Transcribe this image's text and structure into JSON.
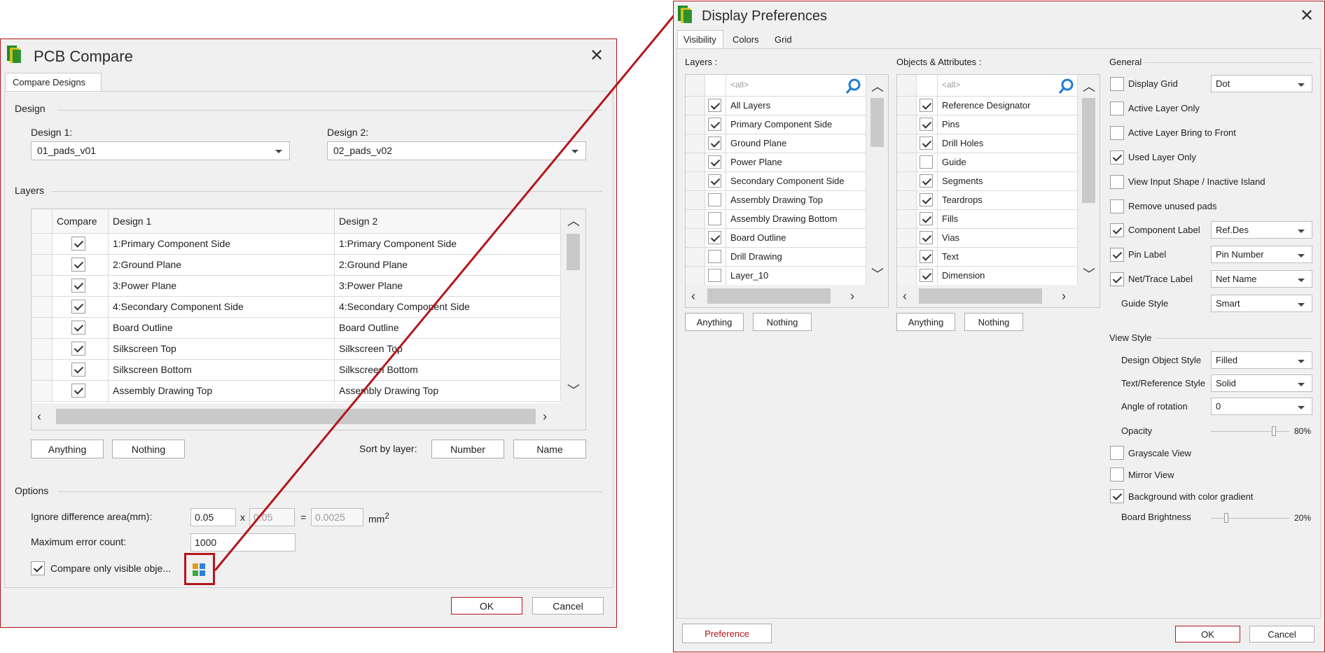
{
  "pcb_compare": {
    "title": "PCB Compare",
    "close": "✕",
    "tab": "Compare Designs",
    "design_section": "Design",
    "design1_label": "Design 1:",
    "design1_value": "01_pads_v01",
    "design2_label": "Design 2:",
    "design2_value": "02_pads_v02",
    "layers_section": "Layers",
    "columns": [
      "Compare",
      "Design 1",
      "Design 2"
    ],
    "rows": [
      {
        "checked": true,
        "d1": "1:Primary Component Side",
        "d2": "1:Primary Component Side"
      },
      {
        "checked": true,
        "d1": "2:Ground Plane",
        "d2": "2:Ground Plane"
      },
      {
        "checked": true,
        "d1": "3:Power Plane",
        "d2": "3:Power Plane"
      },
      {
        "checked": true,
        "d1": "4:Secondary Component Side",
        "d2": "4:Secondary Component Side"
      },
      {
        "checked": true,
        "d1": "Board Outline",
        "d2": "Board Outline"
      },
      {
        "checked": true,
        "d1": "Silkscreen Top",
        "d2": "Silkscreen Top"
      },
      {
        "checked": true,
        "d1": "Silkscreen Bottom",
        "d2": "Silkscreen Bottom"
      },
      {
        "checked": true,
        "d1": "Assembly Drawing Top",
        "d2": "Assembly Drawing Top"
      }
    ],
    "anything": "Anything",
    "nothing": "Nothing",
    "sort_by_label": "Sort by layer:",
    "sort_number": "Number",
    "sort_name": "Name",
    "options_section": "Options",
    "ignore_label": "Ignore difference area(mm):",
    "ignore_a": "0.05",
    "times": "x",
    "ignore_b": "0.05",
    "equals": "=",
    "ignore_result": "0.0025",
    "unit": "mm",
    "unit_sup": "2",
    "max_err_label": "Maximum error count:",
    "max_err_value": "1000",
    "visible_only_label": "Compare only visible obje...",
    "visible_only_checked": true,
    "ok": "OK",
    "cancel": "Cancel"
  },
  "display_prefs": {
    "title": "Display Preferences",
    "close": "✕",
    "tabs": [
      "Visibility",
      "Colors",
      "Grid"
    ],
    "layers_label": "Layers :",
    "objects_label": "Objects & Attributes :",
    "filter_placeholder": "<all>",
    "layers": [
      {
        "checked": true,
        "name": "All Layers"
      },
      {
        "checked": true,
        "name": "Primary Component Side"
      },
      {
        "checked": true,
        "name": "Ground Plane"
      },
      {
        "checked": true,
        "name": "Power Plane"
      },
      {
        "checked": true,
        "name": "Secondary Component Side"
      },
      {
        "checked": false,
        "name": "Assembly Drawing Top"
      },
      {
        "checked": false,
        "name": "Assembly Drawing Bottom"
      },
      {
        "checked": true,
        "name": "Board Outline"
      },
      {
        "checked": false,
        "name": "Drill Drawing"
      },
      {
        "checked": false,
        "name": "Layer_10"
      }
    ],
    "objects": [
      {
        "checked": true,
        "name": "Reference Designator"
      },
      {
        "checked": true,
        "name": "Pins"
      },
      {
        "checked": true,
        "name": "Drill Holes"
      },
      {
        "checked": false,
        "name": "Guide"
      },
      {
        "checked": true,
        "name": "Segments"
      },
      {
        "checked": true,
        "name": "Teardrops"
      },
      {
        "checked": true,
        "name": "Fills"
      },
      {
        "checked": true,
        "name": "Vias"
      },
      {
        "checked": true,
        "name": "Text"
      },
      {
        "checked": true,
        "name": "Dimension"
      }
    ],
    "anything": "Anything",
    "nothing": "Nothing",
    "general_section": "General",
    "display_grid": {
      "label": "Display Grid",
      "checked": false,
      "value": "Dot"
    },
    "active_layer_only": {
      "label": "Active Layer Only",
      "checked": false
    },
    "active_layer_front": {
      "label": "Active Layer Bring to Front",
      "checked": false
    },
    "used_layer_only": {
      "label": "Used Layer Only",
      "checked": true
    },
    "view_input_shape": {
      "label": "View Input Shape / Inactive Island",
      "checked": false
    },
    "remove_unused_pads": {
      "label": "Remove unused pads",
      "checked": false
    },
    "component_label": {
      "label": "Component Label",
      "checked": true,
      "value": "Ref.Des"
    },
    "pin_label": {
      "label": "Pin Label",
      "checked": true,
      "value": "Pin Number"
    },
    "net_trace_label": {
      "label": "Net/Trace Label",
      "checked": true,
      "value": "Net Name"
    },
    "guide_style": {
      "label": "Guide Style",
      "value": "Smart"
    },
    "view_style_section": "View Style",
    "design_object_style": {
      "label": "Design Object Style",
      "value": "Filled"
    },
    "text_reference_style": {
      "label": "Text/Reference Style",
      "value": "Solid"
    },
    "angle_of_rotation": {
      "label": "Angle of rotation",
      "value": "0"
    },
    "opacity": {
      "label": "Opacity",
      "value": "80%",
      "fraction": 0.8
    },
    "grayscale_view": {
      "label": "Grayscale View",
      "checked": false
    },
    "mirror_view": {
      "label": "Mirror View",
      "checked": false
    },
    "background_gradient": {
      "label": "Background with color gradient",
      "checked": true
    },
    "board_brightness": {
      "label": "Board Brightness",
      "value": "20%",
      "fraction": 0.2
    },
    "preference": "Preference",
    "ok": "OK",
    "cancel": "Cancel"
  },
  "colors": {
    "accent": "#b1171c",
    "window_bg": "#f0f0f0"
  }
}
